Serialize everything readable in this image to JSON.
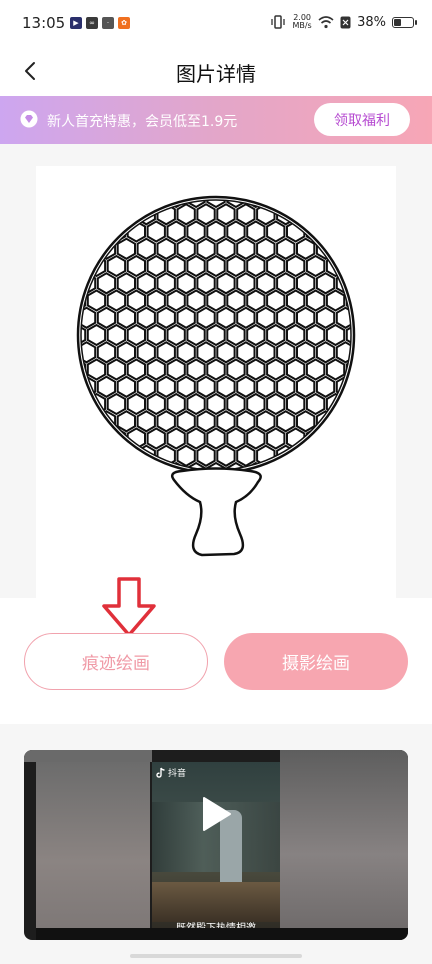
{
  "status_bar": {
    "time": "13:05",
    "speed_value": "2.00",
    "speed_unit": "MB/s",
    "battery": "38%",
    "battery_level": 0.38,
    "notification_icons": [
      "video-app-icon",
      "link-app-icon",
      "store-app-icon",
      "orange-app-icon"
    ]
  },
  "header": {
    "title": "图片详情",
    "back_icon": "chevron-left-icon"
  },
  "promo": {
    "text": "新人首充特惠，会员低至1.9元",
    "button": "领取福利",
    "colors": {
      "start": "#cda6f0",
      "end": "#f7a6b6",
      "button_text": "#b64bd1"
    }
  },
  "actions": {
    "trace_drawing": "痕迹绘画",
    "photo_drawing": "摄影绘画",
    "accent": "#f7a6b0",
    "annotation_arrow_color": "#e0303a"
  },
  "video": {
    "brand": "抖音",
    "caption": "既然殿下热情相邀"
  }
}
